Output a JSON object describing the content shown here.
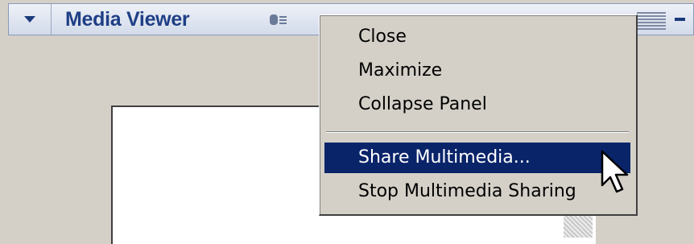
{
  "panel": {
    "title": "Media Viewer"
  },
  "context_menu": {
    "items": [
      {
        "label": "Close"
      },
      {
        "label": "Maximize"
      },
      {
        "label": "Collapse Panel"
      },
      {
        "label": "Share Multimedia..."
      },
      {
        "label": "Stop Multimedia Sharing"
      }
    ],
    "highlighted_item": "Share Multimedia...",
    "highlight_color": "#0a246a"
  },
  "icons": {
    "collapse": "triangle-down-icon",
    "panel_options": "panel-options-icon",
    "grip": "gripper-icon",
    "minimize": "minimize-icon",
    "cursor": "mouse-pointer-icon"
  },
  "colors": {
    "title_text": "#1f3f86",
    "background": "#d4d0c8"
  }
}
